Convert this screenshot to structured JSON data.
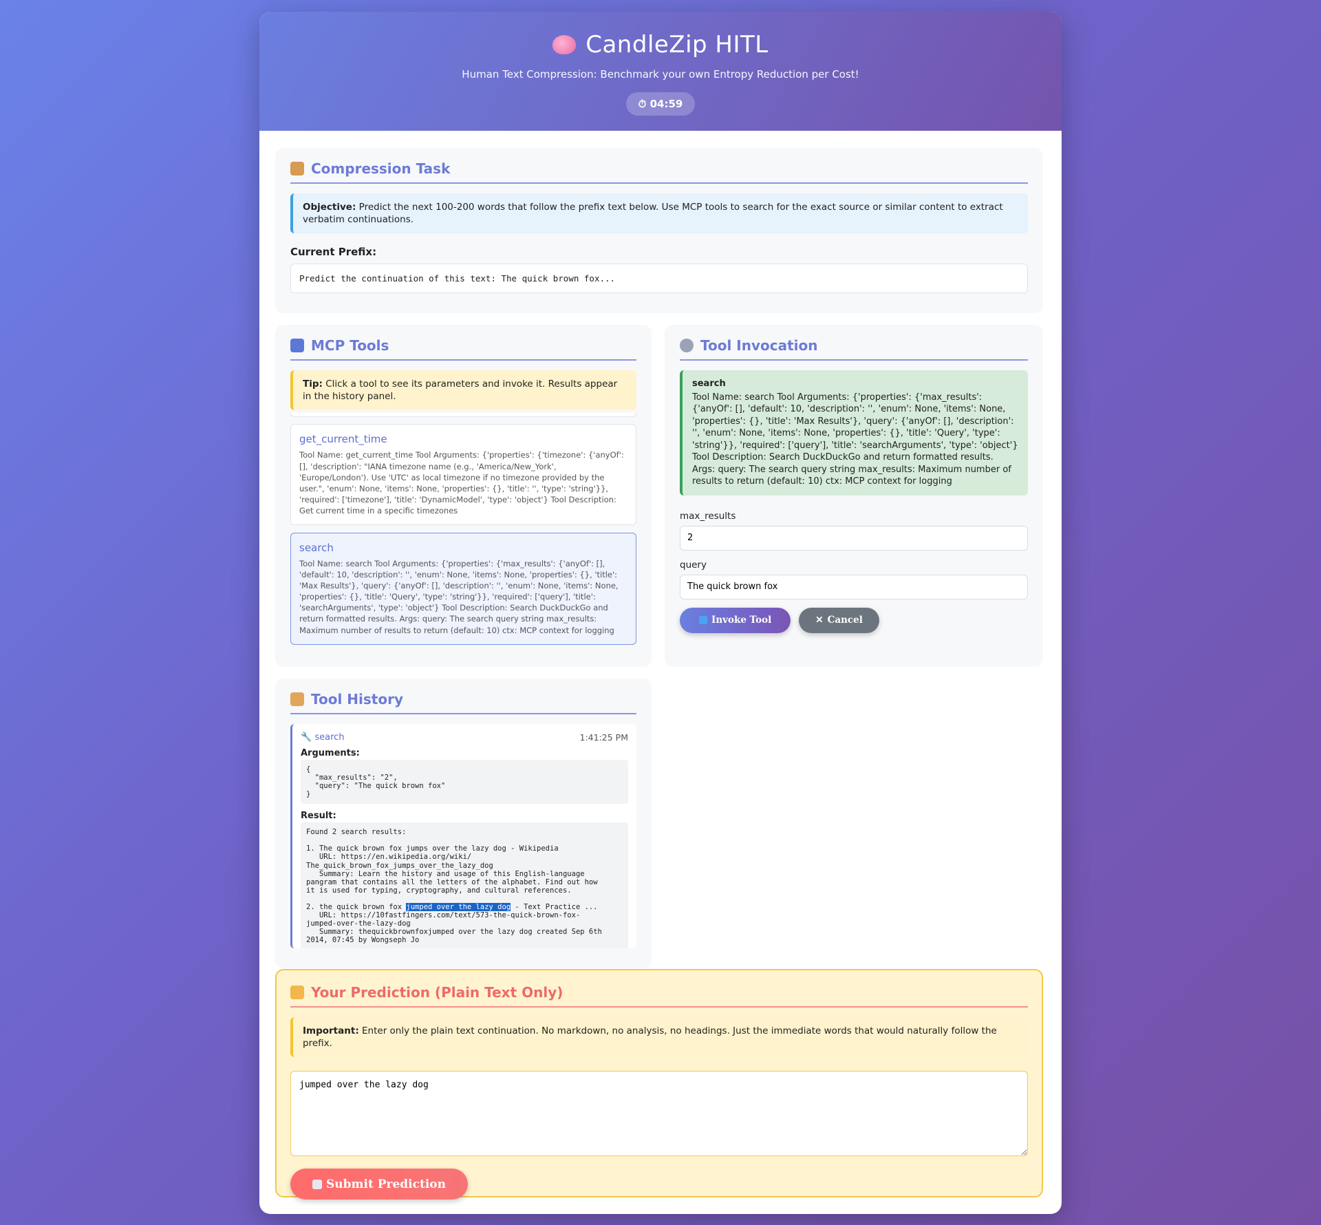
{
  "header": {
    "title": "CandleZip HITL",
    "subtitle": "Human Text Compression: Benchmark your own Entropy Reduction per Cost!",
    "timer": "⏱ 04:59"
  },
  "task": {
    "title": "Compression Task",
    "objective_label": "Objective:",
    "objective_text": " Predict the next 100-200 words that follow the prefix text below. Use MCP tools to search for the exact source or similar content to extract verbatim continuations.",
    "prefix_label": "Current Prefix:",
    "prefix_text": "Predict the continuation of this text: The quick brown fox..."
  },
  "tools": {
    "title": "MCP Tools",
    "tip_label": "Tip:",
    "tip_text": " Click a tool to see its parameters and invoke it. Results appear in the history panel.",
    "items": [
      {
        "name": "get_current_time",
        "desc": "Tool Name: get_current_time Tool Arguments: {'properties': {'timezone': {'anyOf': [], 'description': \"IANA timezone name (e.g., 'America/New_York', 'Europe/London'). Use 'UTC' as local timezone if no timezone provided by the user.\", 'enum': None, 'items': None, 'properties': {}, 'title': '', 'type': 'string'}}, 'required': ['timezone'], 'title': 'DynamicModel', 'type': 'object'} Tool Description: Get current time in a specific timezones"
      },
      {
        "name": "search",
        "desc": "Tool Name: search Tool Arguments: {'properties': {'max_results': {'anyOf': [], 'default': 10, 'description': '', 'enum': None, 'items': None, 'properties': {}, 'title': 'Max Results'}, 'query': {'anyOf': [], 'description': '', 'enum': None, 'items': None, 'properties': {}, 'title': 'Query', 'type': 'string'}}, 'required': ['query'], 'title': 'searchArguments', 'type': 'object'} Tool Description: Search DuckDuckGo and return formatted results. Args: query: The search query string max_results: Maximum number of results to return (default: 10) ctx: MCP context for logging"
      }
    ]
  },
  "invocation": {
    "title": "Tool Invocation",
    "tool_name": "search",
    "tool_desc": "Tool Name: search Tool Arguments: {'properties': {'max_results': {'anyOf': [], 'default': 10, 'description': '', 'enum': None, 'items': None, 'properties': {}, 'title': 'Max Results'}, 'query': {'anyOf': [], 'description': '', 'enum': None, 'items': None, 'properties': {}, 'title': 'Query', 'type': 'string'}}, 'required': ['query'], 'title': 'searchArguments', 'type': 'object'} Tool Description: Search DuckDuckGo and return formatted results. Args: query: The search query string max_results: Maximum number of results to return (default: 10) ctx: MCP context for logging",
    "fields": [
      {
        "label": "max_results",
        "value": "2"
      },
      {
        "label": "query",
        "value": "The quick brown fox"
      }
    ],
    "invoke_label": "Invoke Tool",
    "cancel_label": "Cancel"
  },
  "history": {
    "title": "Tool History",
    "entry": {
      "tool": "search",
      "time": "1:41:25 PM",
      "arguments_label": "Arguments:",
      "arguments": "{\n  \"max_results\": \"2\",\n  \"query\": \"The quick brown fox\"\n}",
      "result_label": "Result:",
      "result_pre": "Found 2 search results:\n\n1. The quick brown fox jumps over the lazy dog - Wikipedia\n   URL: https://en.wikipedia.org/wiki/\nThe_quick_brown_fox_jumps_over_the_lazy_dog\n   Summary: Learn the history and usage of this English-language\npangram that contains all the letters of the alphabet. Find out how\nit is used for typing, cryptography, and cultural references.\n\n2. the quick brown fox ",
      "result_highlight": "jumped over the lazy dog",
      "result_post": " - Text Practice ...\n   URL: https://10fastfingers.com/text/573-the-quick-brown-fox-\njumped-over-the-lazy-dog\n   Summary: thequickbrownfoxjumped over the lazy dog created Sep 6th\n2014, 07:45 by Wongseph Jo"
    }
  },
  "prediction": {
    "title": "Your Prediction (Plain Text Only)",
    "important_label": "Important:",
    "important_text": " Enter only the plain text continuation. No markdown, no analysis, no headings. Just the immediate words that would naturally follow the prefix.",
    "value": "jumped over the lazy dog",
    "submit_label": "Submit Prediction"
  },
  "colors": {
    "accent": "#6c7bd6",
    "submit": "#ff6b6b",
    "success": "#38a05a"
  }
}
